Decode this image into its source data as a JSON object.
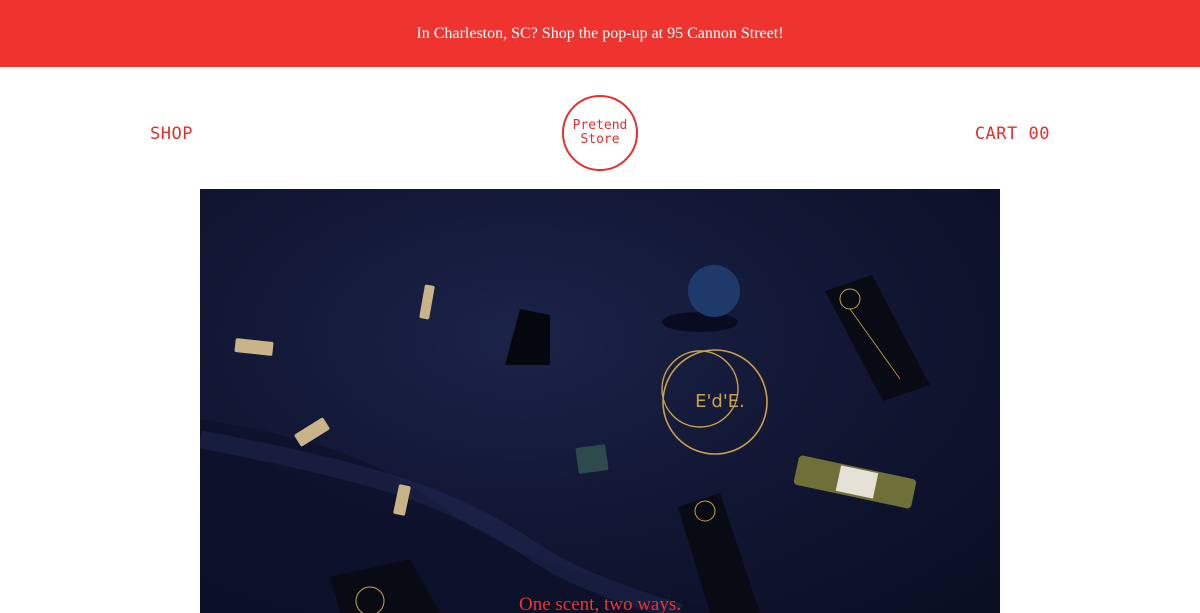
{
  "announcement": {
    "text": "In Charleston, SC? Shop the pop-up at 95 Cannon Street!"
  },
  "nav": {
    "shop_label": "SHOP",
    "cart_label": "CART",
    "cart_count": "00"
  },
  "logo": {
    "line1": "Pretend",
    "line2": "Store"
  },
  "hero": {
    "brand_mark": "E'd'E.",
    "caption": "One scent, two ways."
  },
  "colors": {
    "accent_red": "#ef3430",
    "hero_navy": "#121735",
    "gold": "#c9a24a"
  }
}
